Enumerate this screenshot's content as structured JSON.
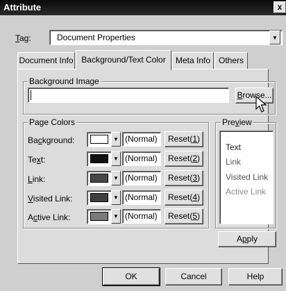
{
  "window": {
    "title": "Attribute",
    "close_label": "x"
  },
  "tag": {
    "label": "Tag:",
    "value": "Document Properties"
  },
  "tabs": [
    {
      "label": "Document Info"
    },
    {
      "label": "Background/Text Color"
    },
    {
      "label": "Meta Info"
    },
    {
      "label": "Others"
    }
  ],
  "background_image": {
    "group_label": "Background Image",
    "value": "",
    "browse_label": "Browse..."
  },
  "page_colors": {
    "group_label": "Page Colors",
    "rows": [
      {
        "label": "Background:",
        "color": "#ffffff",
        "mode": "(Normal)",
        "reset": "Reset(1)"
      },
      {
        "label": "Text:",
        "color": "#111111",
        "mode": "(Normal)",
        "reset": "Reset(2)"
      },
      {
        "label": "Link:",
        "color": "#474747",
        "mode": "(Normal)",
        "reset": "Reset(3)"
      },
      {
        "label": "Visited Link:",
        "color": "#3f3f3f",
        "mode": "(Normal)",
        "reset": "Reset(4)"
      },
      {
        "label": "Active Link:",
        "color": "#7a7a7a",
        "mode": "(Normal)",
        "reset": "Reset(5)"
      }
    ]
  },
  "preview": {
    "group_label": "Preview",
    "items": [
      {
        "label": "Text",
        "color": "#1a1a1a"
      },
      {
        "label": "Link",
        "color": "#5a5a5a"
      },
      {
        "label": "Visited Link",
        "color": "#555555"
      },
      {
        "label": "Active Link",
        "color": "#8a8a8a"
      }
    ]
  },
  "buttons": {
    "apply": "Apply",
    "ok": "OK",
    "cancel": "Cancel",
    "help": "Help"
  }
}
